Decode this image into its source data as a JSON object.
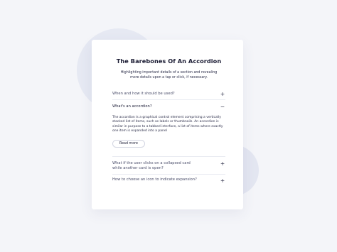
{
  "card": {
    "title": "The Barebones Of An Accordion",
    "subtitle": "Highlighting important details of a section and revealing more details upon a tap or click, if necessary."
  },
  "accordion": {
    "items": [
      {
        "question": "When and how it should be used?",
        "icon": "+",
        "expanded": false
      },
      {
        "question": "What's an accordion?",
        "icon": "−",
        "expanded": true,
        "answer": "The accordion is a graphical control element comprising a vertically stacked list of items, such as labels or thumbnails. An accordion is similar in purpose to a tabbed interface, a list of items where exactly one item is expanded into a panel",
        "button_label": "Read more"
      },
      {
        "question": "What if the user clicks on a collapsed card while another card is open?",
        "icon": "+",
        "expanded": false
      },
      {
        "question": "How to choose an icon to indicate expansion?",
        "icon": "+",
        "expanded": false
      }
    ]
  },
  "colors": {
    "background": "#f4f5f9",
    "card": "#ffffff",
    "blob": "#e6e9f3",
    "text": "#1c1d36",
    "divider": "#e9ebf2"
  }
}
